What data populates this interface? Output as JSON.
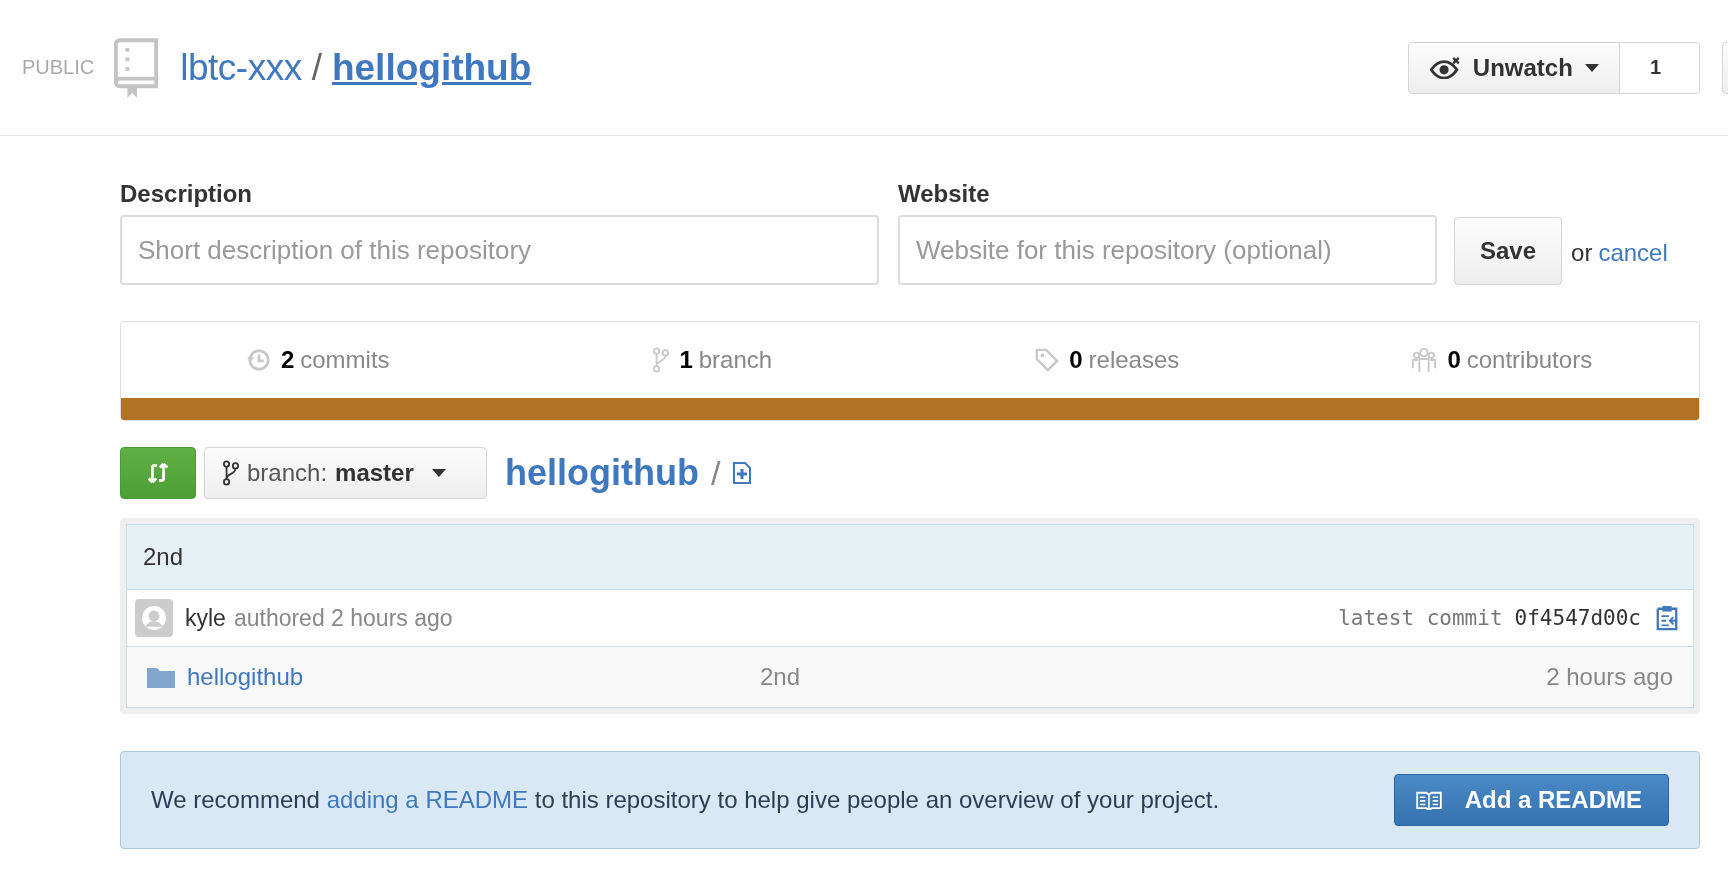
{
  "repo": {
    "visibility": "PUBLIC",
    "owner": "lbtc-xxx",
    "separator": "/",
    "name": "hellogithub"
  },
  "watch": {
    "label": "Unwatch",
    "count": "1"
  },
  "edit_form": {
    "description": {
      "label": "Description",
      "placeholder": "Short description of this repository"
    },
    "website": {
      "label": "Website",
      "placeholder": "Website for this repository (optional)"
    },
    "save": "Save",
    "or": "or",
    "cancel": "cancel"
  },
  "stats": [
    {
      "kind": "commits",
      "count": "2",
      "label": "commits"
    },
    {
      "kind": "branches",
      "count": "1",
      "label": "branch"
    },
    {
      "kind": "releases",
      "count": "0",
      "label": "releases"
    },
    {
      "kind": "contributors",
      "count": "0",
      "label": "contributors"
    }
  ],
  "languages": [
    {
      "color": "#b17226"
    }
  ],
  "branch": {
    "prefix": "branch:",
    "name": "master"
  },
  "breadcrumb": {
    "repo": "hellogithub",
    "separator": "/"
  },
  "commit": {
    "message": "2nd",
    "author": "kyle",
    "action": "authored 2 hours ago",
    "label": "latest commit",
    "sha": "0f4547d00c"
  },
  "files": [
    {
      "kind": "folder",
      "name": "hellogithub",
      "message": "2nd",
      "age": "2 hours ago"
    }
  ],
  "readme_notice": {
    "before": "We recommend",
    "link": "adding a README",
    "after": "to this repository to help give people an overview of your project.",
    "button": "Add a README"
  }
}
